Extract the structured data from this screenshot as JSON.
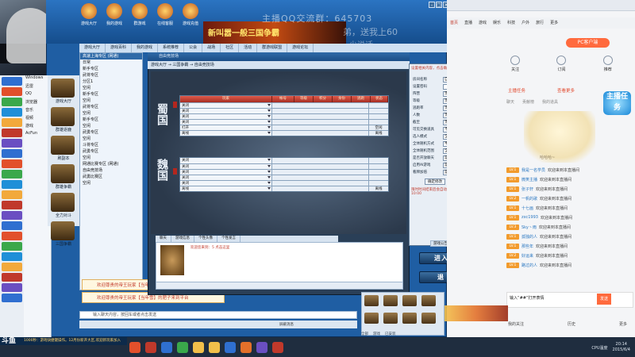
{
  "overlay": {
    "watermark1": "主播QQ交流群：645703",
    "watermark2": "弟，送我上60",
    "watermark3": "少说话"
  },
  "hall": {
    "banner_text": "新叫嚣一般三国争霸",
    "top_icons": [
      "游戏大厅",
      "我的游戏",
      "群游戏",
      "在线客服",
      "游戏充值"
    ],
    "tabs": [
      "游戏大厅",
      "游戏百科",
      "我的游戏",
      "系统推荐",
      "公会",
      "战场",
      "社区",
      "活动",
      "群游戏联盟",
      "游戏论坛"
    ],
    "game_icons": [
      {
        "label": "游戏大厅"
      },
      {
        "label": "群雄逐鹿"
      },
      {
        "label": "刷副本"
      },
      {
        "label": "群雄争霸"
      },
      {
        "label": "全力对斗"
      },
      {
        "label": "三国争霸"
      }
    ],
    "tree": [
      "高速上海专区 (网通)",
      "日常",
      "新手专区",
      "武将专区",
      "分区1",
      "空闲",
      "新手专区",
      "空闲",
      "武将专区",
      "空闲",
      "新手专区",
      "空闲",
      "武勇专区",
      "空闲",
      "斗将专区",
      "武勇专区",
      "空闲",
      "网通比赛专区 (网通)",
      "自由竞技场",
      "武勇比赛区",
      "空闲"
    ],
    "welcome1": "欢迎尊贵的帝王玩家【当年雪】进入游戏",
    "welcome2": "欢迎尊贵的帝王玩家【当年雪】的肥子来到平台",
    "input_placeholder": "输入聊天内容，按回车或者点击发送",
    "checkbox_label": "屏蔽消息"
  },
  "room": {
    "title": "自由竞技场",
    "breadcrumb": "游戏大厅 → 三国争霸 → 自由竞技场",
    "mark_top": "蜀国",
    "mark_bottom": "魏国",
    "columns": [
      "玩家",
      "帐号",
      "等级",
      "积分",
      "身份",
      "逃跑",
      "状态"
    ],
    "shu_rows": [
      {
        "name": "关闭",
        "state": ""
      },
      {
        "name": "关闭",
        "state": ""
      },
      {
        "name": "关闭",
        "state": ""
      },
      {
        "name": "关闭",
        "state": ""
      },
      {
        "name": "打开",
        "state": "空闲"
      },
      {
        "name": "离线",
        "state": "离线"
      }
    ],
    "wei_rows": [
      {
        "name": "关闭",
        "state": ""
      },
      {
        "name": "关闭",
        "state": ""
      },
      {
        "name": "关闭",
        "state": ""
      },
      {
        "name": "关闭",
        "state": ""
      },
      {
        "name": "关闭",
        "state": ""
      },
      {
        "name": "离线",
        "state": "离线"
      }
    ],
    "chat_tabs": [
      "聊天",
      "游戏信息",
      "个性头像",
      "个性发言"
    ],
    "chat_line": "欢迎您来到：5 点击这里"
  },
  "settings": {
    "note": "设置相关内容，点击确认方可生效！",
    "rows": [
      {
        "label": "房间名称",
        "value": "自由竞技场"
      },
      {
        "label": "设置密码",
        "value": ""
      },
      {
        "label": "阵营",
        "value": "无限制"
      },
      {
        "label": "等级",
        "value": "无限制"
      },
      {
        "label": "逃跑率",
        "value": "无限制"
      },
      {
        "label": "人数",
        "value": "无限制"
      },
      {
        "label": "截至",
        "value": "无限制"
      },
      {
        "label": "可见交换道具",
        "value": "不可交换道具"
      },
      {
        "label": "选人模式",
        "value": "全体随机"
      },
      {
        "label": "全体随机方式",
        "value": "半随机"
      },
      {
        "label": "全体随机范围",
        "value": "全体随机"
      },
      {
        "label": "是否开放聊天",
        "value": "是"
      },
      {
        "label": "启用AI游戏",
        "value": "是"
      },
      {
        "label": "看牌加倍",
        "value": "是"
      }
    ],
    "confirm_label": "确定修改",
    "cancel_label": "取消",
    "warning": "限时时间结束后会自动开始游戏，时间：10:00",
    "mini_tabs": [
      "游戏公告",
      "游戏人数"
    ]
  },
  "actions": {
    "pk_label": "进入PK",
    "quit_label": "退出"
  },
  "browser": {
    "tabs": [
      "首页",
      "直播",
      "游戏",
      "娱乐",
      "科技",
      "户外",
      "旅行",
      "更多"
    ],
    "stats": [
      "关注",
      "订阅",
      "推荐"
    ],
    "pc_button": "PC客户端",
    "host_label": "主播任务",
    "host_action": "查看更多",
    "chat_tabs": [
      "聊天",
      "贡献榜",
      "我的道具"
    ],
    "mascot_caption": "哈哈哈~",
    "badge_text": "主播任务",
    "messages": [
      {
        "lv": "LV.1",
        "name": "我是一名学员",
        "text": "欢迎来到本直播间"
      },
      {
        "lv": "LV.1",
        "name": "微笑主播",
        "text": "欢迎来到本直播间"
      },
      {
        "lv": "LV.1",
        "name": "张子轩",
        "text": "欢迎来到本直播间"
      },
      {
        "lv": "LV.2",
        "name": "一帆的歌",
        "text": "欢迎来到本直播间"
      },
      {
        "lv": "LV.1",
        "name": "十七画",
        "text": "欢迎来到本直播间"
      },
      {
        "lv": "LV.1",
        "name": "zxc1993",
        "text": "欢迎来到本直播间"
      },
      {
        "lv": "LV.3",
        "name": "Sky丶雨",
        "text": "欢迎来到本直播间"
      },
      {
        "lv": "LV.1",
        "name": "孤独的人",
        "text": "欢迎来到本直播间"
      },
      {
        "lv": "LV.1",
        "name": "那些年",
        "text": "欢迎来到本直播间"
      },
      {
        "lv": "LV.2",
        "name": "好运来",
        "text": "欢迎来到本直播间"
      },
      {
        "lv": "LV.1",
        "name": "路过的人",
        "text": "欢迎来到本直播间"
      }
    ],
    "input_placeholder": "输入“##”打开表情",
    "send_label": "发送",
    "footer": [
      "我的关注",
      "历史",
      "更多"
    ]
  },
  "game_strip": {
    "tabs": [
      "全部",
      "游戏",
      "已安装"
    ]
  },
  "taskbar": {
    "ticker": "1000秒：游戏快捷键操作。12月份新开大区,欢迎新玩家加入",
    "logo": "斗鱼",
    "time": "20:14",
    "date": "2015/6/4",
    "tray_text": "CPU温度"
  }
}
